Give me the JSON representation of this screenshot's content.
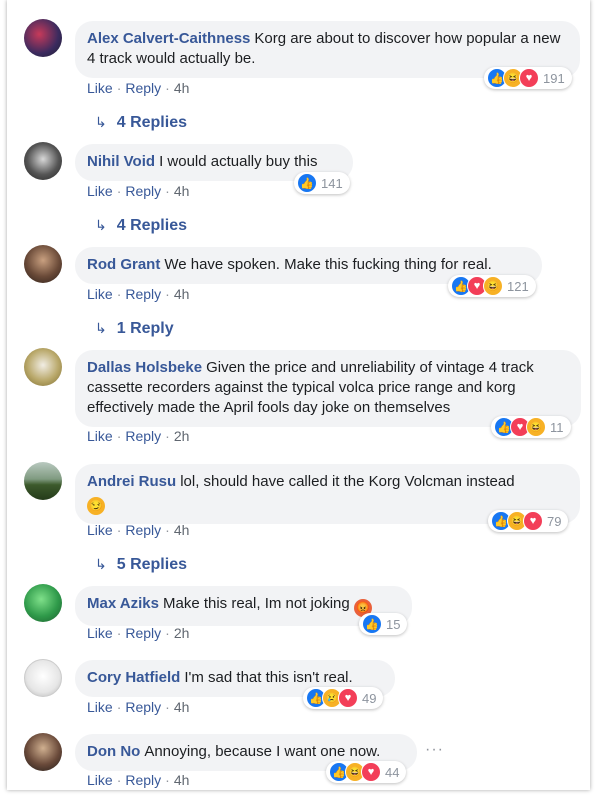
{
  "comments": [
    {
      "author": "Alex Calvert-Caithness",
      "text": "Korg are about to discover how popular a new 4 track would actually be.",
      "like": "Like",
      "reply": "Reply",
      "time": "4h",
      "reaction_count": "191",
      "reactions": [
        "like-icon",
        "haha-icon",
        "love-icon"
      ],
      "replies_label": "4 Replies"
    },
    {
      "author": "Nihil Void",
      "text": "I would actually buy this",
      "like": "Like",
      "reply": "Reply",
      "time": "4h",
      "reaction_count": "141",
      "reactions": [
        "like-icon"
      ],
      "replies_label": "4 Replies"
    },
    {
      "author": "Rod Grant",
      "text": "We have spoken. Make this fucking thing for real.",
      "like": "Like",
      "reply": "Reply",
      "time": "4h",
      "reaction_count": "121",
      "reactions": [
        "like-icon",
        "love-icon",
        "haha-icon"
      ],
      "replies_label": "1 Reply"
    },
    {
      "author": "Dallas Holsbeke",
      "text": "Given the price and unreliability of vintage 4 track cassette recorders against the typical volca price range and korg effectively made the April fools day joke on themselves",
      "like": "Like",
      "reply": "Reply",
      "time": "2h",
      "reaction_count": "11",
      "reactions": [
        "like-icon",
        "love-icon",
        "haha-icon"
      ]
    },
    {
      "author": "Andrei Rusu",
      "text": "lol, should have called it the Korg Volcman instead",
      "like": "Like",
      "reply": "Reply",
      "time": "4h",
      "reaction_count": "79",
      "reactions": [
        "like-icon",
        "haha-icon",
        "love-icon"
      ],
      "replies_label": "5 Replies"
    },
    {
      "author": "Max Aziks",
      "text": "Make this real, Im not joking",
      "like": "Like",
      "reply": "Reply",
      "time": "2h",
      "reaction_count": "15",
      "reactions": [
        "like-icon"
      ]
    },
    {
      "author": "Cory Hatfield",
      "text": "I'm sad that this isn't real.",
      "like": "Like",
      "reply": "Reply",
      "time": "4h",
      "reaction_count": "49",
      "reactions": [
        "like-icon",
        "sad-icon",
        "love-icon"
      ]
    },
    {
      "author": "Don No",
      "text": "Annoying, because I want one now.",
      "like": "Like",
      "reply": "Reply",
      "time": "4h",
      "reaction_count": "44",
      "reactions": [
        "like-icon",
        "haha-icon",
        "love-icon"
      ],
      "more": "···"
    }
  ],
  "colors": {
    "link": "#385898",
    "bubble": "#f2f3f5",
    "like": "#1877f2",
    "love": "#f33e58",
    "haha": "#f7b125"
  }
}
